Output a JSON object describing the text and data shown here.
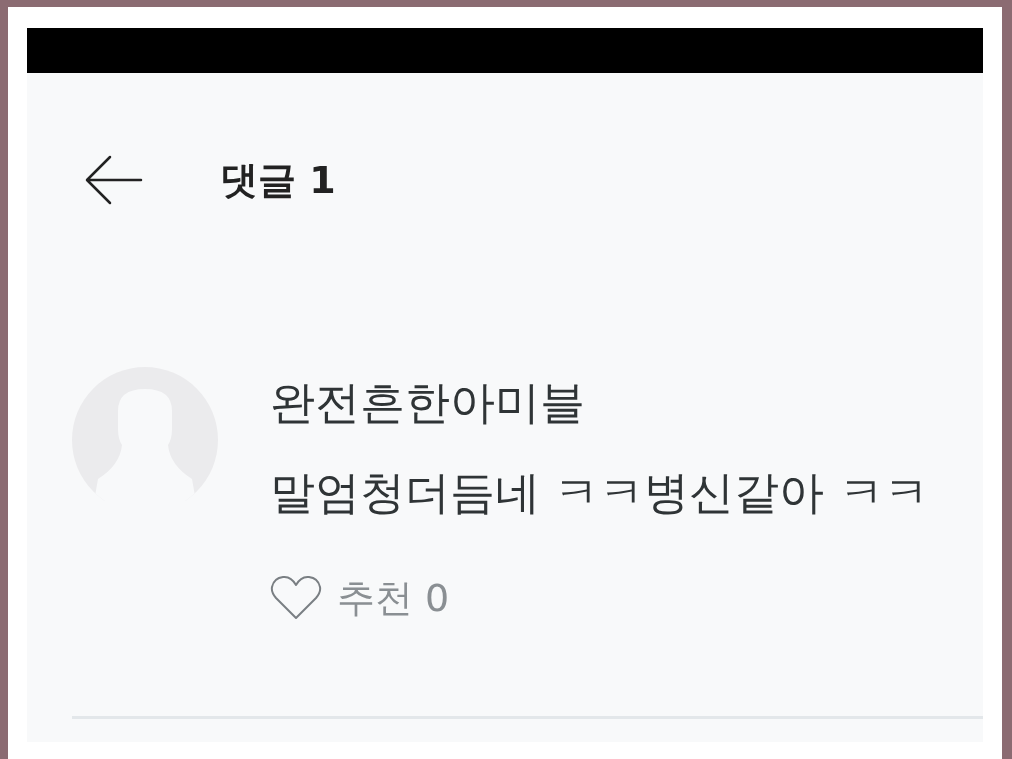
{
  "header": {
    "title": "댓글 1"
  },
  "comments": [
    {
      "author": "완전흔한아미블",
      "text": "말엄청더듬네 ㅋㅋ병신같아 ㅋㅋ",
      "likes_label": "추천 0",
      "liked": false
    }
  ]
}
